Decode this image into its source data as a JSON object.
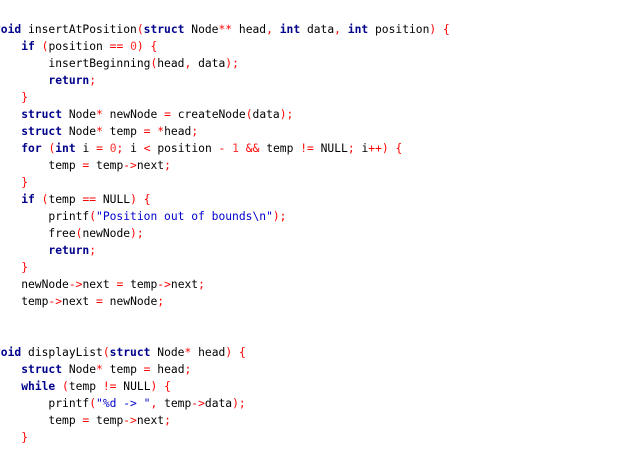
{
  "colors": {
    "background": "#ffffff",
    "identifier": "#000000",
    "keyword": "#00008b",
    "operator": "#ff0000",
    "number": "#ff3333",
    "string": "#0000cc"
  },
  "lines": [
    [
      {
        "t": "kw",
        "v": "void"
      },
      {
        "t": "id",
        "v": " insertAtPosition"
      },
      {
        "t": "op",
        "v": "("
      },
      {
        "t": "kw",
        "v": "struct"
      },
      {
        "t": "id",
        "v": " Node"
      },
      {
        "t": "op",
        "v": "**"
      },
      {
        "t": "id",
        "v": " head"
      },
      {
        "t": "op",
        "v": ","
      },
      {
        "t": "id",
        "v": " "
      },
      {
        "t": "kw",
        "v": "int"
      },
      {
        "t": "id",
        "v": " data"
      },
      {
        "t": "op",
        "v": ","
      },
      {
        "t": "id",
        "v": " "
      },
      {
        "t": "kw",
        "v": "int"
      },
      {
        "t": "id",
        "v": " position"
      },
      {
        "t": "op",
        "v": ")"
      },
      {
        "t": "id",
        "v": " "
      },
      {
        "t": "op",
        "v": "{"
      }
    ],
    [
      {
        "t": "id",
        "v": "    "
      },
      {
        "t": "kw",
        "v": "if"
      },
      {
        "t": "id",
        "v": " "
      },
      {
        "t": "op",
        "v": "("
      },
      {
        "t": "id",
        "v": "position "
      },
      {
        "t": "op",
        "v": "=="
      },
      {
        "t": "id",
        "v": " "
      },
      {
        "t": "num",
        "v": "0"
      },
      {
        "t": "op",
        "v": ")"
      },
      {
        "t": "id",
        "v": " "
      },
      {
        "t": "op",
        "v": "{"
      }
    ],
    [
      {
        "t": "id",
        "v": "        insertBeginning"
      },
      {
        "t": "op",
        "v": "("
      },
      {
        "t": "id",
        "v": "head"
      },
      {
        "t": "op",
        "v": ","
      },
      {
        "t": "id",
        "v": " data"
      },
      {
        "t": "op",
        "v": ");"
      }
    ],
    [
      {
        "t": "id",
        "v": "        "
      },
      {
        "t": "kw",
        "v": "return"
      },
      {
        "t": "op",
        "v": ";"
      }
    ],
    [
      {
        "t": "id",
        "v": "    "
      },
      {
        "t": "op",
        "v": "}"
      }
    ],
    [
      {
        "t": "id",
        "v": "    "
      },
      {
        "t": "kw",
        "v": "struct"
      },
      {
        "t": "id",
        "v": " Node"
      },
      {
        "t": "op",
        "v": "*"
      },
      {
        "t": "id",
        "v": " newNode "
      },
      {
        "t": "op",
        "v": "="
      },
      {
        "t": "id",
        "v": " createNode"
      },
      {
        "t": "op",
        "v": "("
      },
      {
        "t": "id",
        "v": "data"
      },
      {
        "t": "op",
        "v": ");"
      }
    ],
    [
      {
        "t": "id",
        "v": "    "
      },
      {
        "t": "kw",
        "v": "struct"
      },
      {
        "t": "id",
        "v": " Node"
      },
      {
        "t": "op",
        "v": "*"
      },
      {
        "t": "id",
        "v": " temp "
      },
      {
        "t": "op",
        "v": "="
      },
      {
        "t": "id",
        "v": " "
      },
      {
        "t": "op",
        "v": "*"
      },
      {
        "t": "id",
        "v": "head"
      },
      {
        "t": "op",
        "v": ";"
      }
    ],
    [
      {
        "t": "id",
        "v": "    "
      },
      {
        "t": "kw",
        "v": "for"
      },
      {
        "t": "id",
        "v": " "
      },
      {
        "t": "op",
        "v": "("
      },
      {
        "t": "kw",
        "v": "int"
      },
      {
        "t": "id",
        "v": " i "
      },
      {
        "t": "op",
        "v": "="
      },
      {
        "t": "id",
        "v": " "
      },
      {
        "t": "num",
        "v": "0"
      },
      {
        "t": "op",
        "v": ";"
      },
      {
        "t": "id",
        "v": " i "
      },
      {
        "t": "op",
        "v": "<"
      },
      {
        "t": "id",
        "v": " position "
      },
      {
        "t": "op",
        "v": "-"
      },
      {
        "t": "id",
        "v": " "
      },
      {
        "t": "num",
        "v": "1"
      },
      {
        "t": "id",
        "v": " "
      },
      {
        "t": "op",
        "v": "&&"
      },
      {
        "t": "id",
        "v": " temp "
      },
      {
        "t": "op",
        "v": "!="
      },
      {
        "t": "id",
        "v": " NULL"
      },
      {
        "t": "op",
        "v": ";"
      },
      {
        "t": "id",
        "v": " i"
      },
      {
        "t": "op",
        "v": "++)"
      },
      {
        "t": "id",
        "v": " "
      },
      {
        "t": "op",
        "v": "{"
      }
    ],
    [
      {
        "t": "id",
        "v": "        temp "
      },
      {
        "t": "op",
        "v": "="
      },
      {
        "t": "id",
        "v": " temp"
      },
      {
        "t": "op",
        "v": "->"
      },
      {
        "t": "id",
        "v": "next"
      },
      {
        "t": "op",
        "v": ";"
      }
    ],
    [
      {
        "t": "id",
        "v": "    "
      },
      {
        "t": "op",
        "v": "}"
      }
    ],
    [
      {
        "t": "id",
        "v": "    "
      },
      {
        "t": "kw",
        "v": "if"
      },
      {
        "t": "id",
        "v": " "
      },
      {
        "t": "op",
        "v": "("
      },
      {
        "t": "id",
        "v": "temp "
      },
      {
        "t": "op",
        "v": "=="
      },
      {
        "t": "id",
        "v": " NULL"
      },
      {
        "t": "op",
        "v": ")"
      },
      {
        "t": "id",
        "v": " "
      },
      {
        "t": "op",
        "v": "{"
      }
    ],
    [
      {
        "t": "id",
        "v": "        printf"
      },
      {
        "t": "op",
        "v": "("
      },
      {
        "t": "str",
        "v": "\"Position out of bounds\\n\""
      },
      {
        "t": "op",
        "v": ");"
      }
    ],
    [
      {
        "t": "id",
        "v": "        free"
      },
      {
        "t": "op",
        "v": "("
      },
      {
        "t": "id",
        "v": "newNode"
      },
      {
        "t": "op",
        "v": ");"
      }
    ],
    [
      {
        "t": "id",
        "v": "        "
      },
      {
        "t": "kw",
        "v": "return"
      },
      {
        "t": "op",
        "v": ";"
      }
    ],
    [
      {
        "t": "id",
        "v": "    "
      },
      {
        "t": "op",
        "v": "}"
      }
    ],
    [
      {
        "t": "id",
        "v": "    newNode"
      },
      {
        "t": "op",
        "v": "->"
      },
      {
        "t": "id",
        "v": "next "
      },
      {
        "t": "op",
        "v": "="
      },
      {
        "t": "id",
        "v": " temp"
      },
      {
        "t": "op",
        "v": "->"
      },
      {
        "t": "id",
        "v": "next"
      },
      {
        "t": "op",
        "v": ";"
      }
    ],
    [
      {
        "t": "id",
        "v": "    temp"
      },
      {
        "t": "op",
        "v": "->"
      },
      {
        "t": "id",
        "v": "next "
      },
      {
        "t": "op",
        "v": "="
      },
      {
        "t": "id",
        "v": " newNode"
      },
      {
        "t": "op",
        "v": ";"
      }
    ],
    [
      {
        "t": "op",
        "v": "}"
      }
    ],
    [],
    [
      {
        "t": "kw",
        "v": "void"
      },
      {
        "t": "id",
        "v": " displayList"
      },
      {
        "t": "op",
        "v": "("
      },
      {
        "t": "kw",
        "v": "struct"
      },
      {
        "t": "id",
        "v": " Node"
      },
      {
        "t": "op",
        "v": "*"
      },
      {
        "t": "id",
        "v": " head"
      },
      {
        "t": "op",
        "v": ")"
      },
      {
        "t": "id",
        "v": " "
      },
      {
        "t": "op",
        "v": "{"
      }
    ],
    [
      {
        "t": "id",
        "v": "    "
      },
      {
        "t": "kw",
        "v": "struct"
      },
      {
        "t": "id",
        "v": " Node"
      },
      {
        "t": "op",
        "v": "*"
      },
      {
        "t": "id",
        "v": " temp "
      },
      {
        "t": "op",
        "v": "="
      },
      {
        "t": "id",
        "v": " head"
      },
      {
        "t": "op",
        "v": ";"
      }
    ],
    [
      {
        "t": "id",
        "v": "    "
      },
      {
        "t": "kw",
        "v": "while"
      },
      {
        "t": "id",
        "v": " "
      },
      {
        "t": "op",
        "v": "("
      },
      {
        "t": "id",
        "v": "temp "
      },
      {
        "t": "op",
        "v": "!="
      },
      {
        "t": "id",
        "v": " NULL"
      },
      {
        "t": "op",
        "v": ")"
      },
      {
        "t": "id",
        "v": " "
      },
      {
        "t": "op",
        "v": "{"
      }
    ],
    [
      {
        "t": "id",
        "v": "        printf"
      },
      {
        "t": "op",
        "v": "("
      },
      {
        "t": "str",
        "v": "\"%d -> \""
      },
      {
        "t": "op",
        "v": ","
      },
      {
        "t": "id",
        "v": " temp"
      },
      {
        "t": "op",
        "v": "->"
      },
      {
        "t": "id",
        "v": "data"
      },
      {
        "t": "op",
        "v": ");"
      }
    ],
    [
      {
        "t": "id",
        "v": "        temp "
      },
      {
        "t": "op",
        "v": "="
      },
      {
        "t": "id",
        "v": " temp"
      },
      {
        "t": "op",
        "v": "->"
      },
      {
        "t": "id",
        "v": "next"
      },
      {
        "t": "op",
        "v": ";"
      }
    ],
    [
      {
        "t": "id",
        "v": "    "
      },
      {
        "t": "op",
        "v": "}"
      }
    ],
    [
      {
        "t": "op",
        "v": "}"
      }
    ]
  ]
}
